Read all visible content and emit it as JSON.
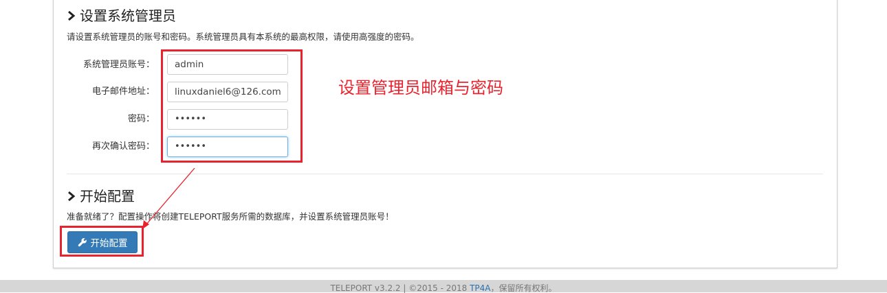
{
  "admin_section": {
    "title": "设置系统管理员",
    "description": "请设置系统管理员的账号和密码。系统管理员具有本系统的最高权限，请使用高强度的密码。",
    "fields": [
      {
        "label": "系统管理员账号：",
        "value": "admin"
      },
      {
        "label": "电子邮件地址：",
        "value": "linuxdaniel6@126.com"
      },
      {
        "label": "密码：",
        "value": "••••••"
      },
      {
        "label": "再次确认密码：",
        "value": "••••••"
      }
    ]
  },
  "config_section": {
    "title": "开始配置",
    "description": "准备就绪了？配置操作将创建TELEPORT服务所需的数据库，并设置系统管理员账号！",
    "button_label": "开始配置"
  },
  "annotation": {
    "text": "设置管理员邮箱与密码",
    "color": "#e8232d"
  },
  "footer": {
    "text_before": "TELEPORT v3.2.2 | ©2015 - 2018 ",
    "link_text": "TP4A",
    "text_after": "，保留所有权利。"
  },
  "colors": {
    "primary": "#337ab7",
    "highlight": "#e8232d"
  },
  "icons": {
    "section_icon": "chevron-right-icon",
    "button_icon": "wrench-icon"
  }
}
